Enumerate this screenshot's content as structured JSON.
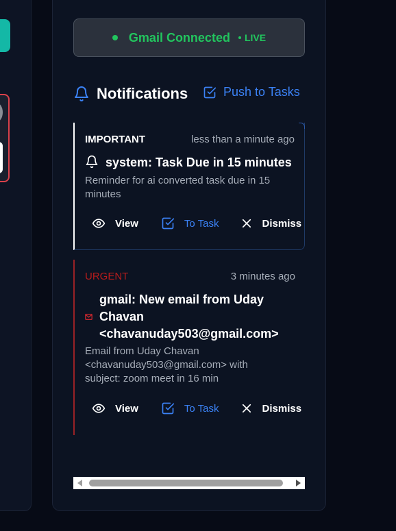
{
  "colors": {
    "accent": "#3b82f6",
    "connected": "#22c55e",
    "urgent": "#b91c1c",
    "panel_bg": "#0c1322"
  },
  "gmail_status": {
    "label": "Gmail Connected",
    "live": "LIVE",
    "icon": "green-dot"
  },
  "notifications": {
    "title": "Notifications",
    "title_icon": "bell-icon",
    "push_label": "Push to Tasks",
    "push_icon": "checkbox-icon",
    "items": [
      {
        "priority": "IMPORTANT",
        "time": "less than a minute ago",
        "icon": "bell-icon",
        "title": "system: Task Due in 15 minutes",
        "description": "Reminder for ai converted task due in 15 minutes",
        "actions": {
          "view": "View",
          "to_task": "To Task",
          "dismiss": "Dismiss"
        }
      },
      {
        "priority": "URGENT",
        "time": "3 minutes ago",
        "icon": "mail-icon",
        "title": "gmail: New email from Uday Chavan <chavanuday503@gmail.com>",
        "description": "Email from Uday Chavan <chavanuday503@gmail.com> with subject: zoom meet in 16 min",
        "actions": {
          "view": "View",
          "to_task": "To Task",
          "dismiss": "Dismiss"
        }
      }
    ]
  }
}
